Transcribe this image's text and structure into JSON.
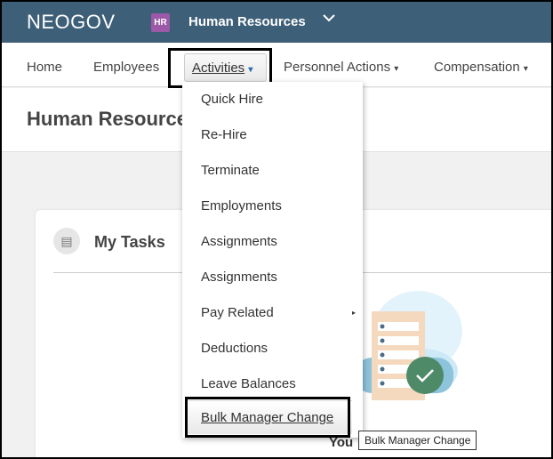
{
  "header": {
    "logo": "NEOGOV",
    "badge": "HR",
    "app": "Human Resources",
    "chevron": "chevron-down-icon"
  },
  "nav": {
    "home": "Home",
    "employees": "Employees",
    "activities": "Activities",
    "personnel": "Personnel Actions",
    "compensation": "Compensation",
    "caret": "▾"
  },
  "page": {
    "title": "Human Resources"
  },
  "card": {
    "title": "My Tasks",
    "you": "You"
  },
  "menu": {
    "items": [
      "Quick Hire",
      "Re-Hire",
      "Terminate",
      "Employments",
      "Assignments",
      "Assignments",
      "Pay Related",
      "Deductions",
      "Leave Balances"
    ],
    "selected": "Bulk Manager Change",
    "submenu_arrow": "▸"
  },
  "tooltip": "Bulk Manager Change",
  "colors": {
    "header": "#3d5f78",
    "badge": "#9b59a8",
    "check": "#4e8a68"
  }
}
